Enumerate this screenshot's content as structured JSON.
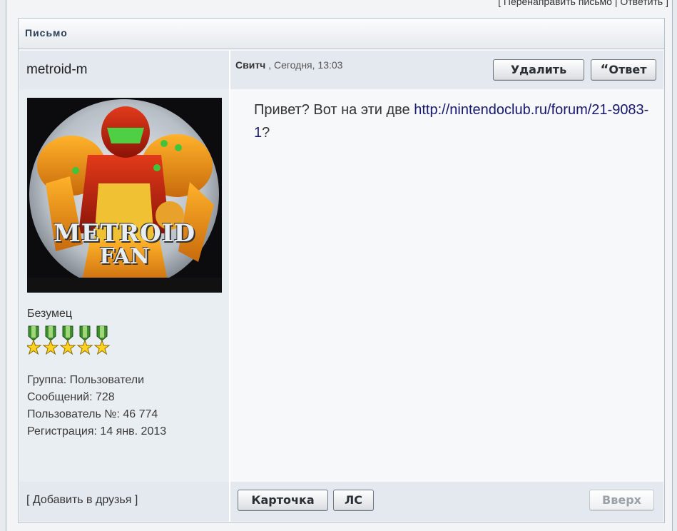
{
  "top_links": {
    "bracket_open": "[",
    "forward": "Перенаправить письмо",
    "divider": "|",
    "reply": "Ответить",
    "bracket_close": "]"
  },
  "message": {
    "header": "Письмо",
    "author": "metroid-m",
    "sender": "Свитч",
    "separator": ",",
    "date": "Сегодня, 13:03",
    "delete_label": "Удалить",
    "reply_label": "Ответ",
    "reply_quote_mark": "“",
    "body_prefix": "Привет? Вот на эти две ",
    "body_link": "http://nintendoclub.ru/forum/21-9083-1",
    "body_suffix": "?",
    "avatar_text_top": "METROID",
    "avatar_text_bottom": "FAN"
  },
  "profile": {
    "rank": "Безумец",
    "medal_count": 5,
    "group": "Группа: Пользователи",
    "posts": "Сообщений: 728",
    "user_no": "Пользователь №: 46 774",
    "registered": "Регистрация: 14 янв. 2013"
  },
  "footer": {
    "add_friend": "[ Добавить в друзья ]",
    "card_label": "Карточка",
    "pm_label": "ЛС",
    "top_label": "Вверх"
  },
  "colors": {
    "header_text": "#2b3f56",
    "link": "#17176e",
    "row_bg": "#e3e9ef"
  }
}
